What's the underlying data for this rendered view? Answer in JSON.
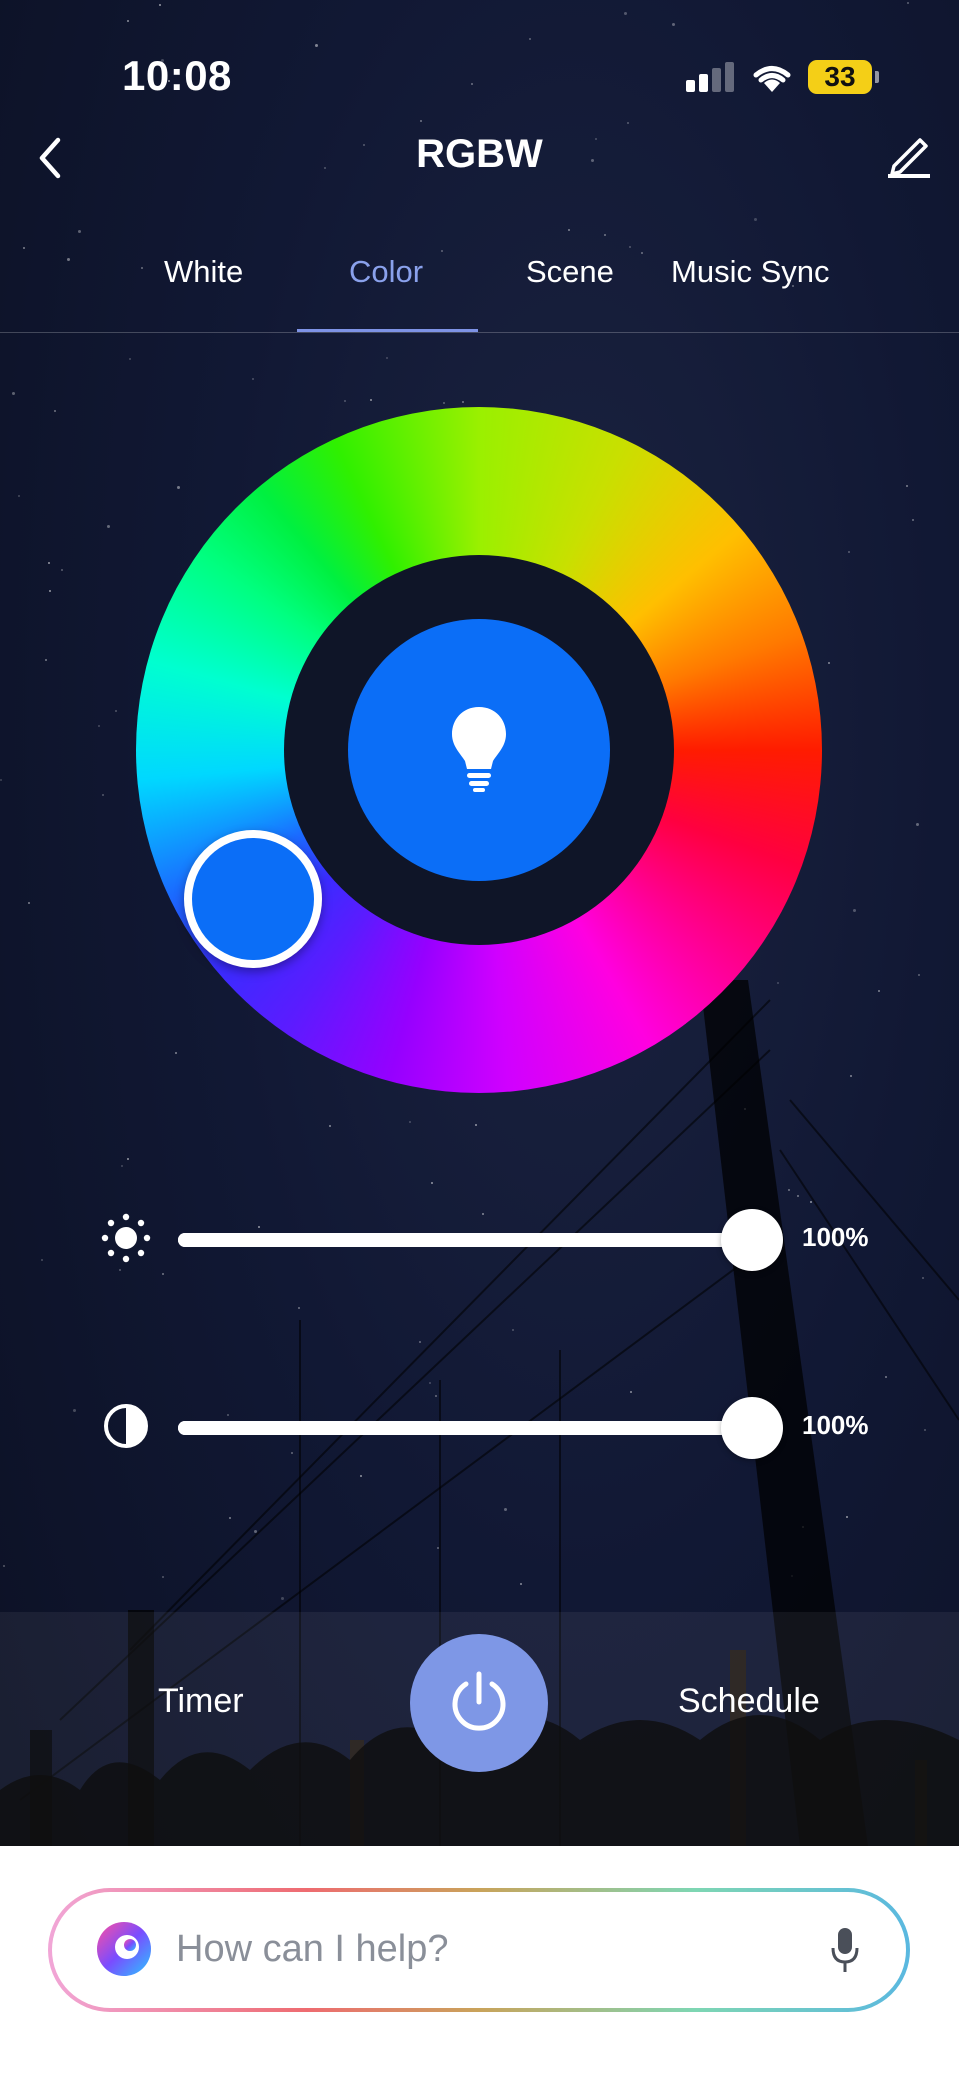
{
  "status_bar": {
    "time": "10:08",
    "battery": "33"
  },
  "header": {
    "title": "RGBW",
    "back_icon": "chevron-left-icon",
    "edit_icon": "pencil-icon"
  },
  "tabs": [
    {
      "label": "White",
      "active": false
    },
    {
      "label": "Color",
      "active": true
    },
    {
      "label": "Scene",
      "active": false
    },
    {
      "label": "Music Sync",
      "active": false
    }
  ],
  "color_wheel": {
    "selected_color": "#0b6ef7",
    "center_icon": "lightbulb-icon"
  },
  "sliders": {
    "brightness": {
      "icon": "sun-icon",
      "value_label": "100%",
      "value": 100
    },
    "saturation": {
      "icon": "contrast-icon",
      "value_label": "100%",
      "value": 100
    }
  },
  "actions": {
    "timer_label": "Timer",
    "schedule_label": "Schedule",
    "power_icon": "power-icon",
    "power_color": "#7e97e6"
  },
  "assistant": {
    "placeholder": "How can I help?",
    "mic_icon": "microphone-icon"
  },
  "colors": {
    "accent": "#8aa1ec",
    "background": "#111834"
  }
}
